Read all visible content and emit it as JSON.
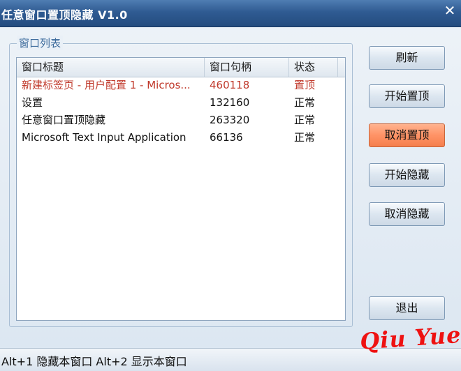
{
  "window": {
    "title": "任意窗口置顶隐藏 V1.0",
    "close_glyph": "✕"
  },
  "group": {
    "legend": "窗口列表"
  },
  "list": {
    "columns": [
      "窗口标题",
      "窗口句柄",
      "状态"
    ],
    "rows": [
      {
        "title": "新建标签页 - 用户配置 1 - Micros...",
        "handle": "460118",
        "status": "置顶",
        "highlighted": true
      },
      {
        "title": "设置",
        "handle": "132160",
        "status": "正常",
        "highlighted": false
      },
      {
        "title": "任意窗口置顶隐藏",
        "handle": "263320",
        "status": "正常",
        "highlighted": false
      },
      {
        "title": "Microsoft Text Input Application",
        "handle": "66136",
        "status": "正常",
        "highlighted": false
      }
    ]
  },
  "buttons": {
    "refresh": "刷新",
    "start_top": "开始置顶",
    "cancel_top": "取消置顶",
    "start_hide": "开始隐藏",
    "cancel_hide": "取消隐藏",
    "exit": "退出"
  },
  "status_bar": {
    "text": "Alt+1 隐藏本窗口 Alt+2 显示本窗口"
  },
  "watermark": {
    "text": "Qiu Yue"
  },
  "colors": {
    "highlight_text": "#c0392b",
    "active_button": "#ff9366",
    "title_bar": "#2f5b92",
    "watermark": "#ee1111"
  }
}
